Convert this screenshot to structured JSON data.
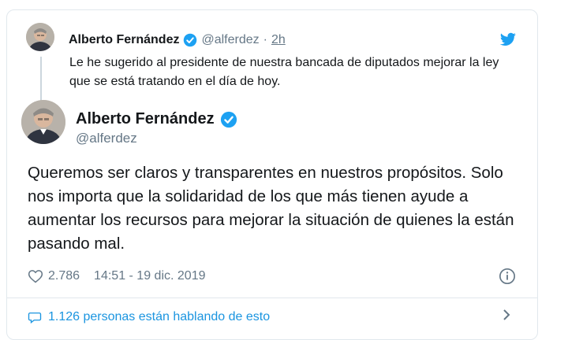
{
  "reply": {
    "name": "Alberto Fernández",
    "handle": "@alferdez",
    "dot": "·",
    "time": "2h",
    "text": "Le he sugerido al presidente de nuestra bancada de diputados mejorar la ley que se está tratando en el día de hoy."
  },
  "main": {
    "name": "Alberto Fernández",
    "handle": "@alferdez",
    "text": "Queremos ser claros y transparentes en nuestros propósitos. Solo nos importa que la solidaridad de los que más tienen ayude a aumentar los recursos para mejorar la situación de quienes la están pasando mal.",
    "likes": "2.786",
    "timestamp": "14:51 - 19 dic. 2019"
  },
  "conversation": {
    "text": "1.126 personas están hablando de esto"
  },
  "icons": {
    "brand": "twitter-bird-icon",
    "verified": "verified-badge-icon",
    "like": "heart-icon",
    "info": "info-icon",
    "conversation": "speech-bubble-icon",
    "more": "chevron-right-icon"
  },
  "colors": {
    "twitter_blue": "#1da1f2",
    "link_blue": "#1b95e0",
    "secondary_text": "#657786",
    "primary_text": "#14171a",
    "border": "#e1e8ed"
  }
}
